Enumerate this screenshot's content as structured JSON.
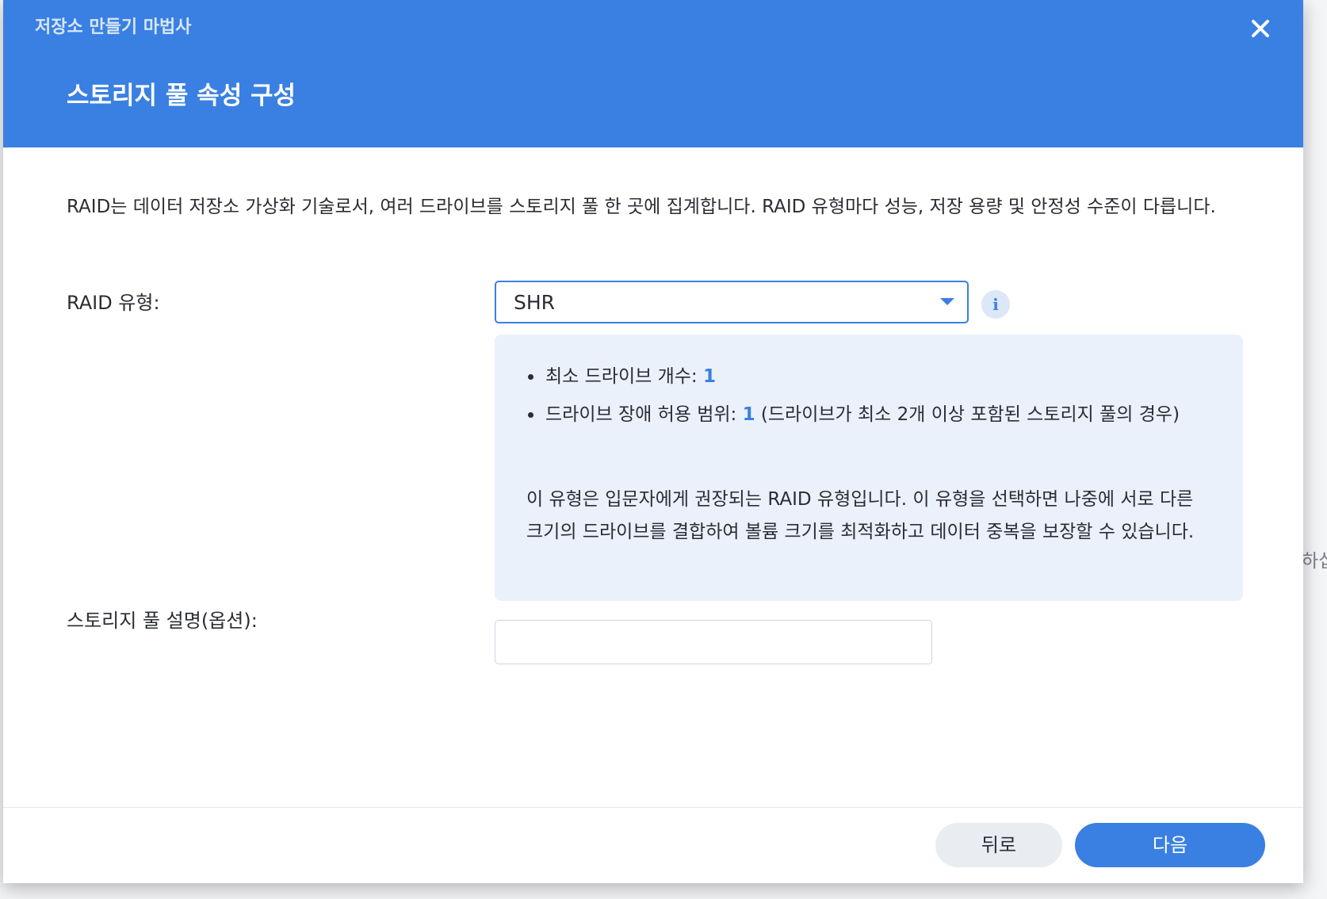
{
  "header": {
    "wizard_title": "저장소 만들기 마법사",
    "step_title": "스토리지 풀 속성 구성",
    "close_icon": "close-icon"
  },
  "intro_text": "RAID는 데이터 저장소 가상화 기술로서, 여러 드라이브를 스토리지 풀 한 곳에 집계합니다. RAID 유형마다 성능, 저장 용량 및 안정성 수준이 다릅니다.",
  "raid_type": {
    "label": "RAID 유형:",
    "selected": "SHR",
    "info_icon": "info-icon"
  },
  "raid_info": {
    "min_drives_label": "최소 드라이브 개수: ",
    "min_drives_value": "1",
    "fault_tolerance_label": "드라이브 장애 허용 범위: ",
    "fault_tolerance_value": "1",
    "fault_tolerance_note": " (드라이브가 최소 2개 이상 포함된 스토리지 풀의 경우)",
    "description": "이 유형은 입문자에게 권장되는 RAID 유형입니다. 이 유형을 선택하면 나중에 서로 다른 크기의 드라이브를 결합하여 볼륨 크기를 최적화하고 데이터 중복을 보장할 수 있습니다."
  },
  "description_field": {
    "label": "스토리지 풀 설명(옵션):",
    "value": "",
    "placeholder": ""
  },
  "footer": {
    "back_label": "뒤로",
    "next_label": "다음"
  },
  "background_fragment": "하십",
  "colors": {
    "accent": "#3a80e2",
    "info_panel_bg": "#ebf1fb",
    "text": "#2a2d33"
  }
}
